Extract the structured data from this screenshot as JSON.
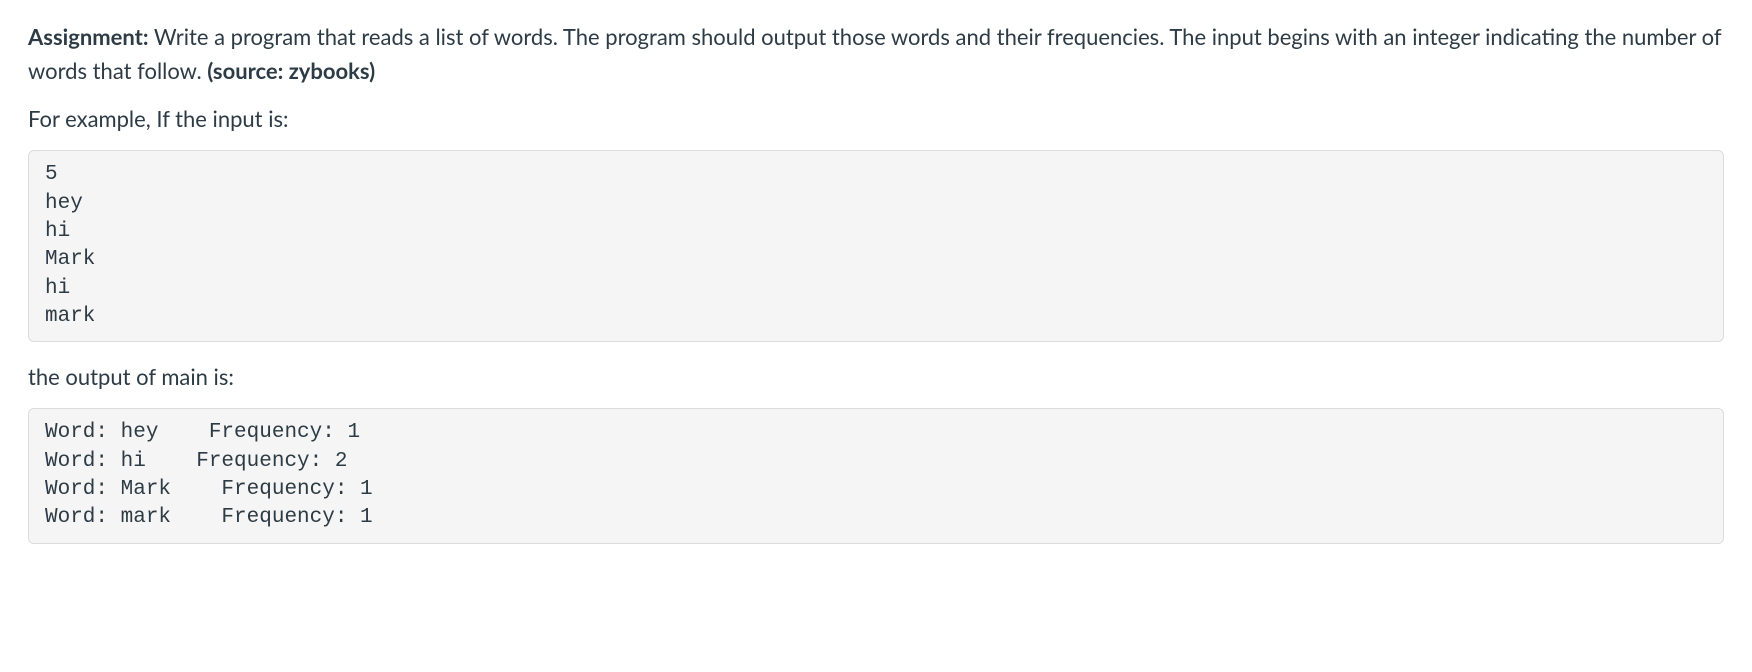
{
  "assignment": {
    "label": "Assignment:",
    "description": " Write a program that reads a list of words.  The program should output those words and their frequencies.  The input begins with an integer indicating the number of words that follow. ",
    "source_label": "(source: zybooks)"
  },
  "example_intro": "For example, If the input is:",
  "input_code": "5\nhey\nhi\nMark\nhi\nmark",
  "output_intro": "the output of main is:",
  "output_code": "Word: hey    Frequency: 1\nWord: hi    Frequency: 2\nWord: Mark    Frequency: 1\nWord: mark    Frequency: 1"
}
